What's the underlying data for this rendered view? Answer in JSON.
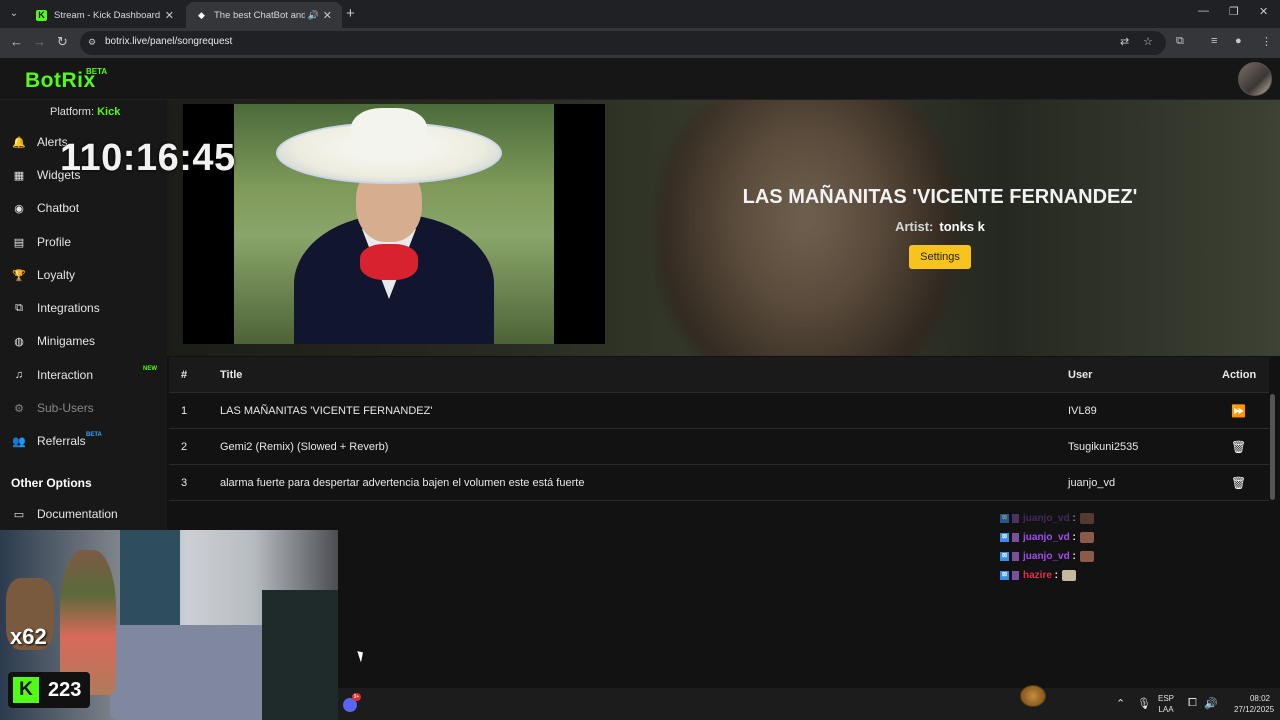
{
  "browser": {
    "tabs": [
      {
        "title": "Stream - Kick Dashboard",
        "favicon": "K"
      },
      {
        "title": "The best ChatBot and Widg",
        "favicon": "◆"
      }
    ],
    "url": "botrix.live/panel/songrequest"
  },
  "app": {
    "logo": "BotRix",
    "logo_badge": "BETA",
    "platform_label": "Platform:",
    "platform_value": "Kick"
  },
  "sidebar": {
    "items": [
      {
        "label": "Alerts",
        "icon": "alerts-icon"
      },
      {
        "label": "Widgets",
        "icon": "widgets-icon"
      },
      {
        "label": "Chatbot",
        "icon": "robot-icon"
      },
      {
        "label": "Profile",
        "icon": "profile-icon"
      },
      {
        "label": "Loyalty",
        "icon": "trophy-icon"
      },
      {
        "label": "Integrations",
        "icon": "integrations-icon"
      },
      {
        "label": "Minigames",
        "icon": "gamepad-icon"
      },
      {
        "label": "Interaction",
        "icon": "music-icon",
        "badge": "NEW"
      },
      {
        "label": "Sub-Users",
        "icon": "sub-users-icon"
      },
      {
        "label": "Referrals",
        "icon": "users-icon",
        "badge": "BETA"
      }
    ],
    "other_heading": "Other Options",
    "documentation": "Documentation"
  },
  "overlay": {
    "timer": "110:16:45",
    "multiplier": "x62",
    "kick_count": "223"
  },
  "now_playing": {
    "title": "LAS MAÑANITAS 'VICENTE FERNANDEZ'",
    "artist_label": "Artist:",
    "artist": "tonks k",
    "settings_label": "Settings"
  },
  "queue": {
    "headers": {
      "num": "#",
      "title": "Title",
      "user": "User",
      "action": "Action"
    },
    "rows": [
      {
        "num": "1",
        "title": "LAS MAÑANITAS 'VICENTE FERNANDEZ'",
        "user": "IVL89",
        "action_icon": "skip-forward-icon"
      },
      {
        "num": "2",
        "title": "Gemi2 (Remix) (Slowed + Reverb)",
        "user": "Tsugikuni2535",
        "action_icon": "trash-icon"
      },
      {
        "num": "3",
        "title": "alarma fuerte para despertar advertencia bajen el volumen este está fuerte",
        "user": "juanjo_vd",
        "action_icon": "trash-icon"
      }
    ]
  },
  "chat": {
    "lines": [
      {
        "user": "juanjo_vd",
        "color": "#6a3a9a"
      },
      {
        "user": "juanjo_vd",
        "color": "#a04ef0"
      },
      {
        "user": "juanjo_vd",
        "color": "#a04ef0"
      },
      {
        "user": "hazire",
        "color": "#e0304a"
      }
    ]
  },
  "taskbar": {
    "lang": "ESP",
    "lang2": "LAA",
    "time": "08:02",
    "date": "27/12/2025",
    "discord_badge": "9+"
  },
  "colors": {
    "brand": "#53fc18",
    "settings_button": "#f7c31d"
  }
}
